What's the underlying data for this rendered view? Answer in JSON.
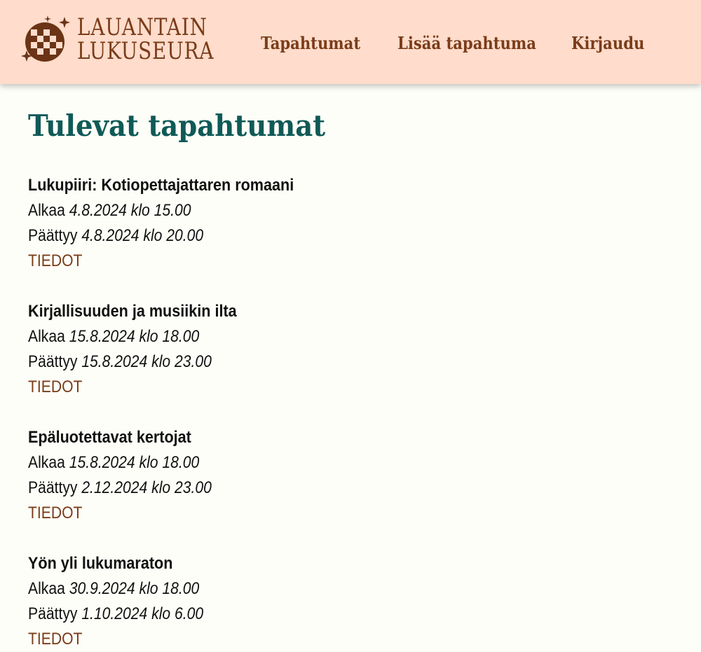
{
  "header": {
    "logo": {
      "line1": "LAUANTAIN",
      "line2": "LUKUSEURA",
      "icon": "disco-ball-icon"
    },
    "nav": [
      {
        "label": "Tapahtumat"
      },
      {
        "label": "Lisää tapahtuma"
      },
      {
        "label": "Kirjaudu"
      }
    ]
  },
  "main": {
    "heading": "Tulevat tapahtumat",
    "start_label": "Alkaa",
    "end_label": "Päättyy",
    "events": [
      {
        "title": "Lukupiiri: Kotiopettajattaren romaani",
        "start": "4.8.2024 klo 15.00",
        "end": "4.8.2024 klo 20.00",
        "link": "TIEDOT"
      },
      {
        "title": "Kirjallisuuden ja musiikin ilta",
        "start": "15.8.2024 klo 18.00",
        "end": "15.8.2024 klo 23.00",
        "link": "TIEDOT"
      },
      {
        "title": "Epäluotettavat kertojat",
        "start": "15.8.2024 klo 18.00",
        "end": "2.12.2024 klo 23.00",
        "link": "TIEDOT"
      },
      {
        "title": "Yön yli lukumaraton",
        "start": "30.9.2024 klo 18.00",
        "end": "1.10.2024 klo 6.00",
        "link": "TIEDOT"
      }
    ]
  },
  "colors": {
    "header_bg": "#ffdccb",
    "page_bg": "#fefef8",
    "brand_brown": "#7a3c19",
    "heading_teal": "#0f5a57"
  }
}
